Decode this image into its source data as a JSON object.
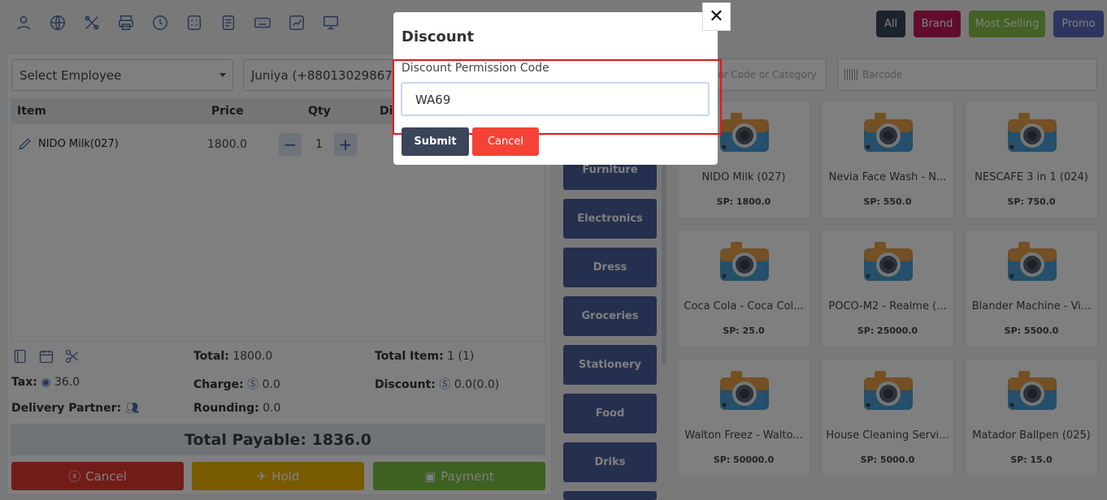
{
  "toolbar": {
    "icons": [
      "customer-icon",
      "globe-icon",
      "tools-icon",
      "printer-icon",
      "history-icon",
      "calculator-icon",
      "register-icon",
      "keyboard-icon",
      "chart-icon",
      "monitor-icon"
    ]
  },
  "filters": {
    "all": "All",
    "brand": "Brand",
    "most_selling": "Most Selling",
    "promo": "Promo"
  },
  "order": {
    "employee_select": "Select Employee",
    "customer_select": "Juniya (+8801302986732)",
    "columns": {
      "item": "Item",
      "price": "Price",
      "qty": "Qty",
      "discount": "Di"
    },
    "rows": [
      {
        "item": "NIDO Milk(027)",
        "price": "1800.0",
        "qty": "1"
      }
    ]
  },
  "summary": {
    "total_label": "Total:",
    "total_value": "1800.0",
    "total_item_label": "Total Item:",
    "total_item_value": "1 (1)",
    "tax_label": "Tax:",
    "tax_value": "36.0",
    "charge_label": "Charge:",
    "charge_value": "0.0",
    "discount_label": "Discount:",
    "discount_value": "0.0(0.0)",
    "delivery_label": "Delivery Partner:",
    "rounding_label": "Rounding:",
    "rounding_value": "0.0",
    "payable": "Total Payable: 1836.0"
  },
  "actions": {
    "cancel": "Cancel",
    "hold": "Hold",
    "payment": "Payment"
  },
  "categories": [
    "Furniture",
    "Electronics",
    "Dress",
    "Groceries",
    "Stationery",
    "Food",
    "Driks"
  ],
  "search": {
    "product_placeholder": "Name or Code or Category",
    "barcode_placeholder": "Barcode"
  },
  "products": [
    {
      "name": "NIDO Milk (027)",
      "price": "SP: 1800.0"
    },
    {
      "name": "Nevia Face Wash - N...",
      "price": "SP: 550.0"
    },
    {
      "name": "NESCAFE 3 in 1 (024)",
      "price": "SP: 750.0"
    },
    {
      "name": "Coca Cola - Coca Col...",
      "price": "SP: 25.0"
    },
    {
      "name": "POCO-M2 - Realme (...",
      "price": "SP: 25000.0"
    },
    {
      "name": "Blander Machine - Vi...",
      "price": "SP: 5500.0"
    },
    {
      "name": "Walton Freez - Walto...",
      "price": "SP: 50000.0"
    },
    {
      "name": "House Cleaning Servi...",
      "price": "SP: 5000.0"
    },
    {
      "name": "Matador Ballpen (025)",
      "price": "SP: 15.0"
    }
  ],
  "modal": {
    "title": "Discount",
    "field_label": "Discount Permission Code",
    "field_value": "WA69",
    "submit": "Submit",
    "cancel": "Cancel"
  },
  "colors": {
    "all": "#3a4658",
    "brand": "#c2185b",
    "most_selling": "#8bc34a",
    "promo": "#5c6bc0",
    "cancel": "#e53935",
    "hold": "#f0b400",
    "payment": "#7cc142",
    "category": "#4a5f9c",
    "highlight": "#e8141a",
    "submit": "#3a4658",
    "modal_cancel": "#f44336"
  }
}
